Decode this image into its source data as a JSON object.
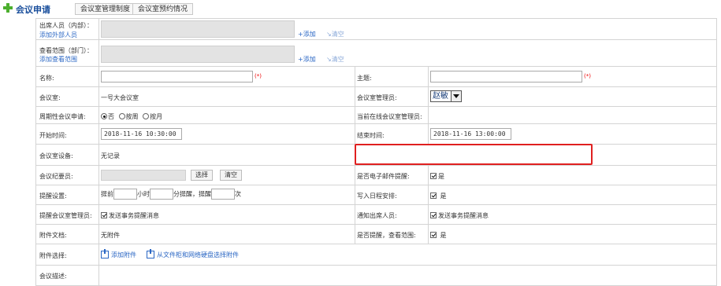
{
  "header": {
    "title": "会议申请",
    "tabs": [
      "会议室管理制度",
      "会议室预约情况"
    ]
  },
  "attendees": {
    "label": "出席人员（内部）：",
    "external_link": "添加外部人员",
    "add_label": "添加",
    "clear_label": "清空"
  },
  "scope": {
    "label": "查看范围（部门）：",
    "add_link": "添加查看范围",
    "add_label": "添加",
    "clear_label": "清空"
  },
  "name": {
    "label": "名称:",
    "value": "",
    "required": "(*)"
  },
  "subject": {
    "label": "主题:",
    "value": "",
    "required": "(*)"
  },
  "room": {
    "label": "会议室:",
    "value": "一号大会议室"
  },
  "room_admin": {
    "label": "会议室管理员:",
    "selected": "赵敏"
  },
  "periodic": {
    "label": "周期性会议申请:",
    "options": [
      "否",
      "按周",
      "按月"
    ]
  },
  "online_admin": {
    "label": "当前在线会议室管理员:"
  },
  "start": {
    "label": "开始时间:",
    "value": "2018-11-16 10:30:00"
  },
  "end": {
    "label": "结束时间:",
    "value": "2018-11-16 13:00:00"
  },
  "equipment": {
    "label": "会议室设备:",
    "value": "无记录"
  },
  "recorder": {
    "label": "会议纪要员:",
    "select_label": "选择",
    "clear_label": "清空"
  },
  "email_remind": {
    "label": "是否电子邮件提醒:",
    "value": "是"
  },
  "reminder": {
    "label": "提醒设置:",
    "prefix": "提前",
    "hour": "小时",
    "minute": "分提醒，提醒",
    "times": "次"
  },
  "schedule": {
    "label": "写入日程安排:",
    "value": "是"
  },
  "remind_admin": {
    "label": "提醒会议室管理员:",
    "value": "发送事务提醒消息"
  },
  "notify_attendees": {
    "label": "通知出席人员:",
    "value": "发送事务提醒消息"
  },
  "attachment_doc": {
    "label": "附件文档:",
    "value": "无附件"
  },
  "remind_scope": {
    "label": "是否提醒，查看范围:",
    "value": "是"
  },
  "attachment_select": {
    "label": "附件选择:",
    "add": "添加附件",
    "from_cabinet": "从文件柜和网络硬盘选择附件"
  },
  "description": {
    "label": "会议描述:"
  }
}
